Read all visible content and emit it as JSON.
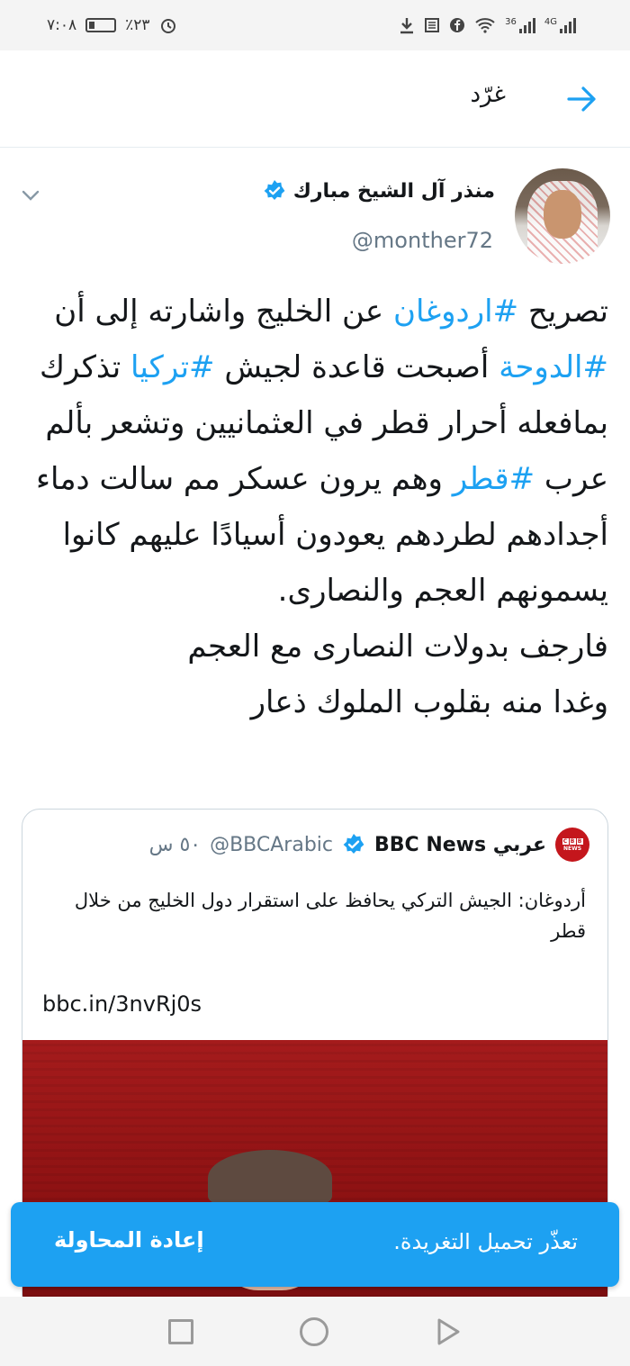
{
  "status_bar": {
    "time": "٧:٠٨",
    "battery": "٪٢٣",
    "battery_level": 0.23,
    "net1": "36",
    "net2": "4G"
  },
  "header": {
    "title": "غرّد"
  },
  "tweet": {
    "author_name": "منذر آل الشيخ مبارك",
    "handle": "@monther72",
    "text_parts": [
      {
        "t": "تصريح ",
        "tag": false
      },
      {
        "t": "#اردوغان",
        "tag": true
      },
      {
        "t": " عن الخليج واشارته إلى أن ",
        "tag": false
      },
      {
        "t": "#الدوحة",
        "tag": true
      },
      {
        "t": " أصبحت قاعدة لجيش ",
        "tag": false
      },
      {
        "t": "#تركيا",
        "tag": true
      },
      {
        "t": " تذكرك بمافعله أحرار قطر في العثمانيين وتشعر بألم عرب ",
        "tag": false
      },
      {
        "t": "#قطر",
        "tag": true
      },
      {
        "t": " وهم يرون عسكر مم سالت دماء أجدادهم لطردهم يعودون أسيادًا عليهم كانوا يسمونهم العجم والنصارى.",
        "tag": false
      },
      {
        "t": "\nفارجف بدولات النصارى مع العجم\nوغدا منه بقلوب الملوك ذعار",
        "tag": false
      }
    ]
  },
  "quoted": {
    "name": "عربي BBC News",
    "handle": "@BBCArabic",
    "time": "٥٠ س",
    "text": "أردوغان: الجيش التركي يحافظ على استقرار دول الخليج من خلال قطر",
    "link": "bbc.in/3nvRj0s",
    "logo_letters": [
      "B",
      "B",
      "C"
    ],
    "logo_sub": "NEWS"
  },
  "toast": {
    "message": "تعذّر تحميل التغريدة.",
    "button": "إعادة المحاولة"
  },
  "colors": {
    "accent": "#1da1f2",
    "bbc_red": "#c4161c",
    "muted": "#657786"
  }
}
